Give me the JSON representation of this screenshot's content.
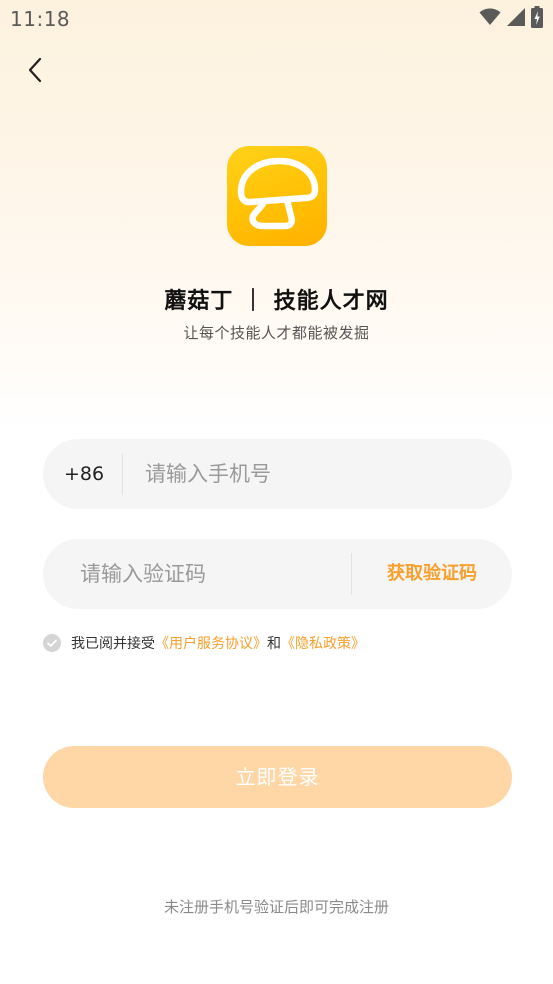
{
  "status_bar": {
    "time": "11:18",
    "icons": [
      "wifi-icon",
      "signal-icon",
      "battery-charging-icon"
    ]
  },
  "nav": {
    "back_icon": "chevron-left-icon"
  },
  "brand": {
    "logo_icon": "mushroom-icon",
    "title": "蘑菇丁 ｜ 技能人才网",
    "slogan": "让每个技能人才都能被发掘",
    "logo_color": "#ffc105"
  },
  "form": {
    "phone": {
      "country_code": "+86",
      "placeholder": "请输入手机号",
      "value": ""
    },
    "code": {
      "placeholder": "请输入验证码",
      "value": "",
      "get_code_label": "获取验证码"
    },
    "agreement": {
      "checked": false,
      "prefix": "我已阅并接受",
      "terms_link": "《用户服务协议》",
      "conjunction": "和",
      "privacy_link": "《隐私政策》"
    },
    "login_label": "立即登录"
  },
  "footer": {
    "note": "未注册手机号验证后即可完成注册"
  },
  "colors": {
    "accent": "#f7a02d",
    "button_disabled": "#ffd7a6",
    "input_bg": "#f5f5f5"
  }
}
